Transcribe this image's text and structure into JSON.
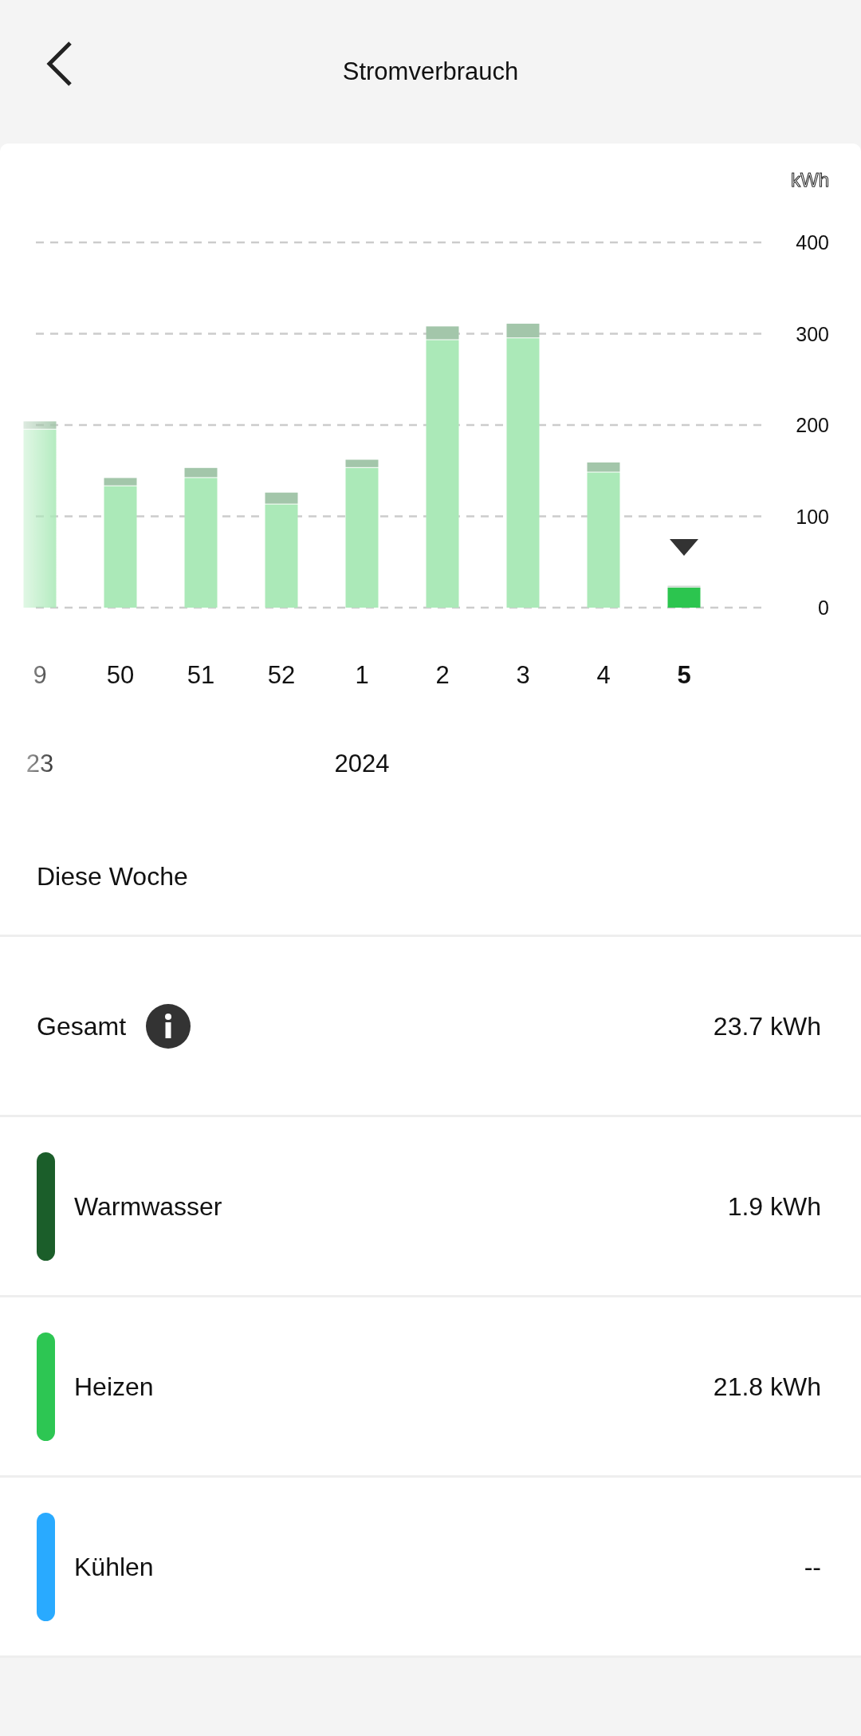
{
  "header": {
    "title": "Stromverbrauch"
  },
  "chart": {
    "unit": "kWh",
    "chart_data": {
      "type": "bar",
      "stacked": true,
      "grid": true,
      "categories": [
        "9",
        "50",
        "51",
        "52",
        "1",
        "2",
        "3",
        "4",
        "5"
      ],
      "series": [
        {
          "color": "#abe9b8",
          "values": [
            195,
            133,
            142,
            113,
            153,
            293,
            295,
            148,
            null
          ]
        },
        {
          "color": "#a3c6aa",
          "values": [
            9,
            9,
            11,
            13,
            9,
            15,
            16,
            11,
            null
          ]
        },
        {
          "color": "#2cc54f",
          "values": [
            null,
            null,
            null,
            null,
            null,
            null,
            null,
            null,
            22
          ]
        },
        {
          "color": "#cfd8d1",
          "values": [
            null,
            null,
            null,
            null,
            null,
            null,
            null,
            null,
            2
          ]
        }
      ],
      "ylim": [
        0,
        400
      ],
      "yticks": [
        0,
        100,
        200,
        300,
        400
      ]
    },
    "weeks": [
      {
        "selected": false,
        "year": "23"
      },
      {
        "selected": false
      },
      {
        "selected": false
      },
      {
        "selected": false
      },
      {
        "selected": false,
        "year": "2024"
      },
      {
        "selected": false
      },
      {
        "selected": false
      },
      {
        "selected": false
      },
      {
        "selected": true
      }
    ]
  },
  "period": {
    "label": "Diese Woche"
  },
  "total": {
    "label": "Gesamt",
    "value": "23.7 kWh"
  },
  "breakdown": [
    {
      "label": "Warmwasser",
      "value": "1.9 kWh",
      "color": "#1b5e2a"
    },
    {
      "label": "Heizen",
      "value": "21.8 kWh",
      "color": "#2dc653"
    },
    {
      "label": "Kühlen",
      "value": "--",
      "color": "#29aaff"
    }
  ]
}
